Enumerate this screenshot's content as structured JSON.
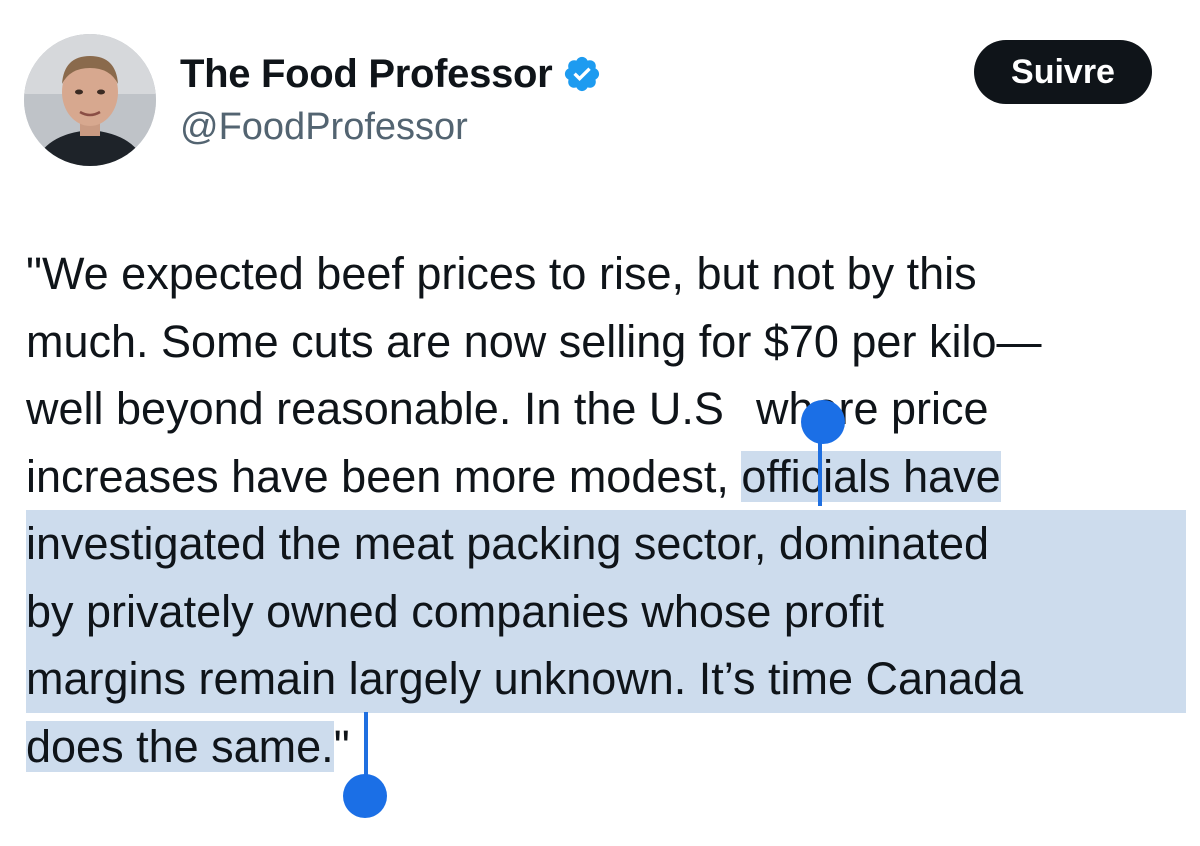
{
  "author": {
    "display_name": "The Food Professor",
    "handle": "@FoodProfessor",
    "verified_icon": "verified-badge-icon",
    "avatar_icon": "profile-photo"
  },
  "follow_button": {
    "label": "Suivre"
  },
  "tweet": {
    "lines": [
      "\"We expected beef prices to rise, but not by this",
      "much. Some cuts are now selling for $70 per kilo—",
      "well beyond reasonable. In the U.S",
      "where price",
      "increases have been more modest, ",
      "officials have",
      "investigated the meat packing sector, dominated",
      "by privately owned companies whose profit",
      "margins remain largely unknown. It’s time Canada",
      "does the same.",
      "\""
    ]
  },
  "colors": {
    "selection": "#cddced",
    "selection_handle": "#1b6fe6",
    "follow_button_bg": "#0f1419",
    "verified": "#1d9bf0",
    "handle_text": "#536471"
  }
}
